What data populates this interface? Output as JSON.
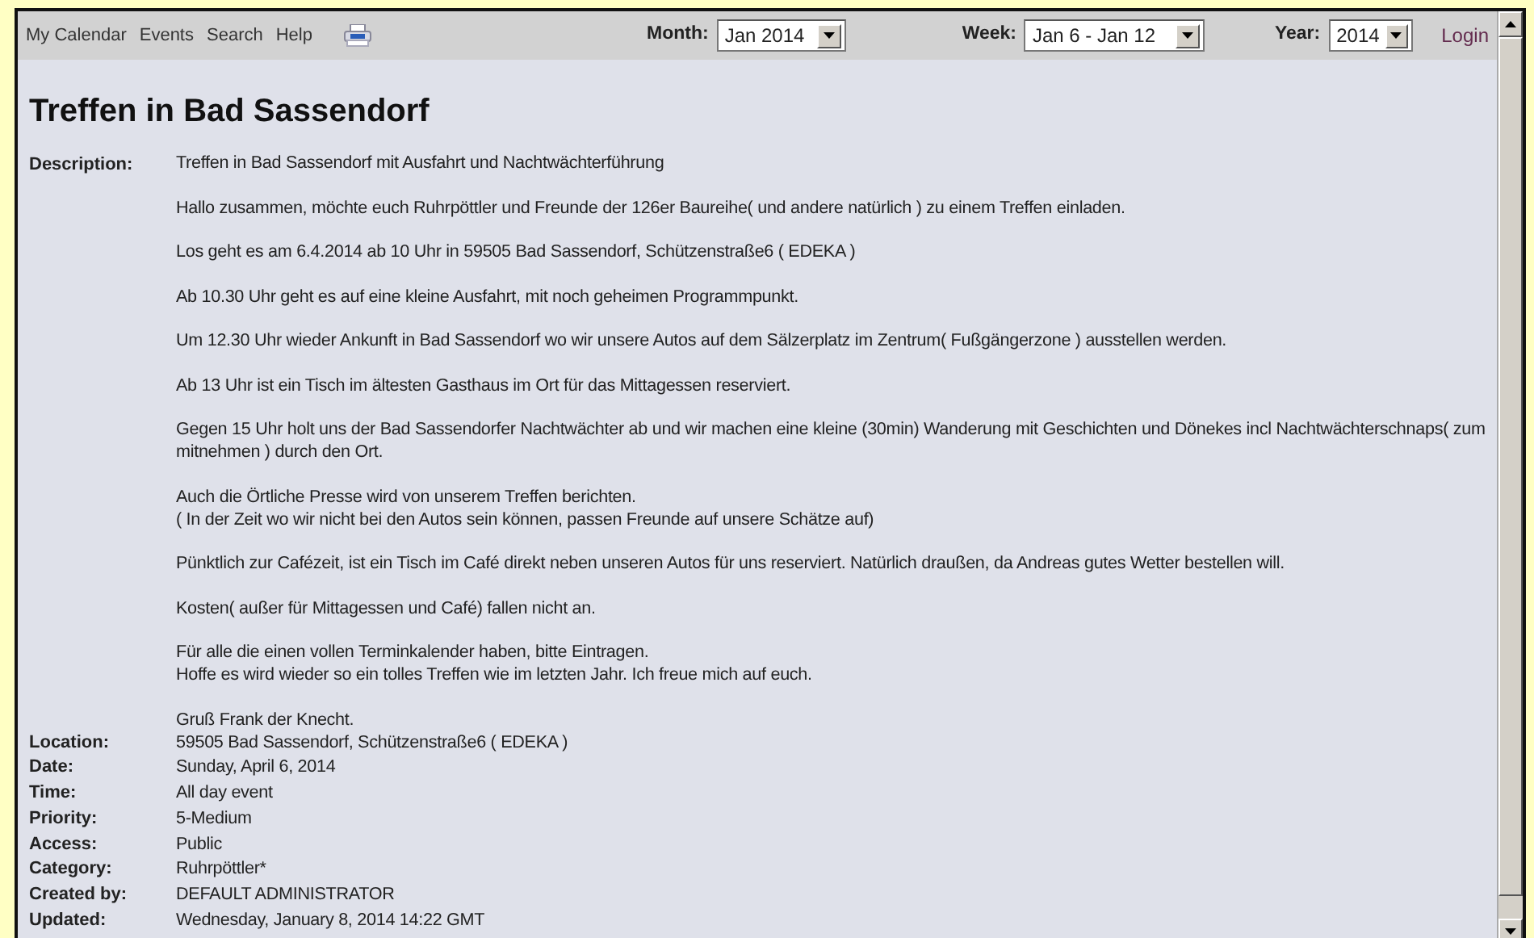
{
  "menu": {
    "links": [
      "My Calendar",
      "Events",
      "Search",
      "Help"
    ],
    "selectors": [
      {
        "label": "Month:",
        "value": "Jan 2014"
      },
      {
        "label": "Week:",
        "value": "Jan 6 - Jan 12"
      },
      {
        "label": "Year:",
        "value": "2014"
      }
    ],
    "login": "Login"
  },
  "event": {
    "title": "Treffen in Bad Sassendorf",
    "description": {
      "label": "Description:",
      "paragraphs": [
        [
          "Treffen in Bad Sassendorf mit Ausfahrt und Nachtwächterführung"
        ],
        [
          "Hallo zusammen, möchte euch Ruhrpöttler und Freunde der 126er Baureihe( und andere natürlich ) zu einem Treffen einladen."
        ],
        [
          "Los geht es am 6.4.2014 ab 10 Uhr in 59505 Bad Sassendorf, Schützenstraße6 ( EDEKA )"
        ],
        [
          "Ab 10.30 Uhr geht es auf eine kleine Ausfahrt, mit noch geheimen Programmpunkt."
        ],
        [
          "Um 12.30 Uhr wieder Ankunft in Bad Sassendorf wo wir unsere Autos auf dem Sälzerplatz im Zentrum( Fußgängerzone ) ausstellen werden."
        ],
        [
          "Ab 13 Uhr ist ein Tisch im ältesten Gasthaus im Ort für das Mittagessen reserviert."
        ],
        [
          "Gegen 15 Uhr holt uns der Bad Sassendorfer Nachtwächter ab und wir machen eine kleine (30min) Wanderung mit Geschichten und Dönekes incl Nachtwächterschnaps( zum mitnehmen ) durch den Ort."
        ],
        [
          "Auch die Örtliche Presse wird von unserem Treffen berichten.",
          "( In der Zeit wo wir nicht bei den Autos sein können, passen Freunde auf unsere Schätze auf)"
        ],
        [
          "Pünktlich zur Cafézeit, ist ein Tisch im Café direkt neben unseren Autos für uns reserviert. Natürlich draußen, da Andreas gutes Wetter bestellen will."
        ],
        [
          "Kosten( außer für Mittagessen und Café) fallen nicht an."
        ],
        [
          "Für alle die einen vollen Terminkalender haben, bitte Eintragen.",
          "Hoffe es wird wieder so ein tolles Treffen wie im letzten Jahr. Ich freue mich auf euch."
        ],
        [
          "Gruß Frank der Knecht."
        ]
      ]
    },
    "details": [
      {
        "label": "Location:",
        "value": "59505 Bad Sassendorf, Schützenstraße6 ( EDEKA )"
      },
      {
        "label": "Date:",
        "value": "Sunday, April 6, 2014"
      },
      {
        "label": "Time:",
        "value": "All day event"
      },
      {
        "label": "Priority:",
        "value": "5-Medium"
      },
      {
        "label": "Access:",
        "value": "Public"
      },
      {
        "label": "Category:",
        "value": "Ruhrpöttler*"
      },
      {
        "label": "Created by:",
        "value": "DEFAULT ADMINISTRATOR"
      },
      {
        "label": "Updated:",
        "value": "Wednesday, January 8, 2014 14:22 GMT"
      }
    ]
  }
}
